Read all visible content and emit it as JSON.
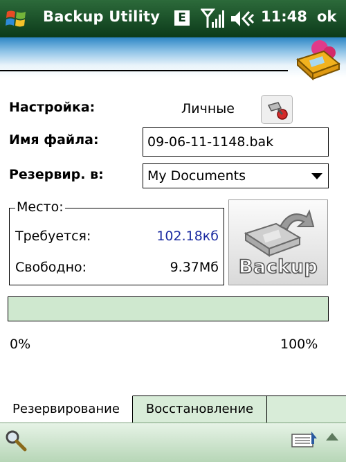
{
  "titlebar": {
    "app_title": "Backup Utility",
    "network_badge": "E",
    "clock": "11:48",
    "ok_label": "ok",
    "icons": [
      "windows-start-icon",
      "signal-icon",
      "volume-icon"
    ]
  },
  "form": {
    "settings_label": "Настройка:",
    "settings_value": "Личные",
    "filename_label": "Имя файла:",
    "filename_value": "09-06-11-1148.bak",
    "destination_label": "Резервир. в:",
    "destination_value": "My Documents"
  },
  "space": {
    "legend": "Место:",
    "required_label": "Требуется:",
    "required_value": "102.18кб",
    "free_label": "Свободно:",
    "free_value": "9.37Мб"
  },
  "backup_button": {
    "label": "Backup"
  },
  "progress": {
    "value": 0,
    "min_label": "0%",
    "max_label": "100%"
  },
  "tabs": [
    {
      "label": "Резервирование",
      "active": true
    },
    {
      "label": "Восстановление",
      "active": false
    }
  ],
  "colors": {
    "title_bar": "#0c3a1a",
    "required_value": "#1a2aa0",
    "progress_track": "#cfe8cf",
    "tab_strip": "#d8ecd8"
  }
}
